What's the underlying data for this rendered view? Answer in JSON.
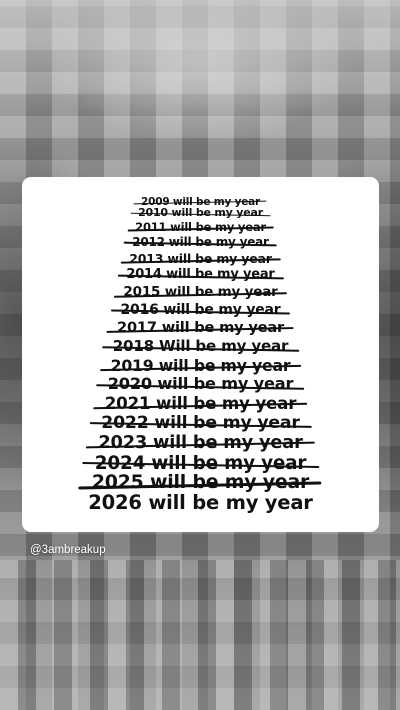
{
  "lines": [
    {
      "text": "2009 will be my year",
      "crossed": true
    },
    {
      "text": "2010 will be my year",
      "crossed": true
    },
    {
      "text": "2011 will be my year",
      "crossed": true
    },
    {
      "text": "2012 will be my year",
      "crossed": true
    },
    {
      "text": "2013 will be my year",
      "crossed": true
    },
    {
      "text": "2014 will be my year",
      "crossed": true
    },
    {
      "text": "2015 will be my year",
      "crossed": true
    },
    {
      "text": "2016 will be my year",
      "crossed": true
    },
    {
      "text": "2017 will be my year",
      "crossed": true
    },
    {
      "text": "2018 Will be my year",
      "crossed": true
    },
    {
      "text": "2019 will be my year",
      "crossed": true
    },
    {
      "text": "2020 will be my year",
      "crossed": true
    },
    {
      "text": "2021 will be my year",
      "crossed": true
    },
    {
      "text": "2022 will be my year",
      "crossed": true
    },
    {
      "text": "2023 will be my year",
      "crossed": true
    },
    {
      "text": "2024 will be my year",
      "crossed": true
    },
    {
      "text": "2025 will be my year",
      "crossed": true
    },
    {
      "text": "2026 will be my year",
      "crossed": false
    }
  ],
  "caption": {
    "handle": "@3ambreakup"
  },
  "colors": {
    "text": "#111111",
    "card": "#ffffff"
  }
}
